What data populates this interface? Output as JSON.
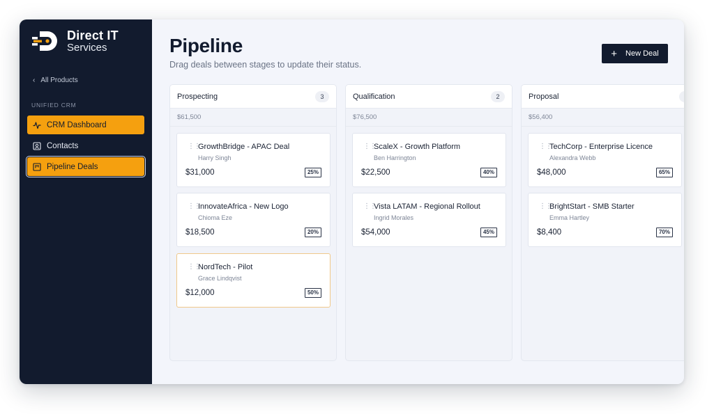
{
  "brand": {
    "name": "Direct IT",
    "subtitle": "Services"
  },
  "sidebar": {
    "back_label": "All Products",
    "section_label": "UNIFIED CRM",
    "items": [
      {
        "label": "CRM Dashboard",
        "icon": "activity-icon",
        "state": "active"
      },
      {
        "label": "Contacts",
        "icon": "contact-card-icon",
        "state": "default"
      },
      {
        "label": "Pipeline Deals",
        "icon": "kanban-icon",
        "state": "selected"
      }
    ]
  },
  "header": {
    "title": "Pipeline",
    "subtitle": "Drag deals between stages to update their status.",
    "new_deal_label": "New Deal"
  },
  "columns": [
    {
      "title": "Prospecting",
      "count": "3",
      "total": "$61,500",
      "cards": [
        {
          "title": "GrowthBridge - APAC Deal",
          "owner": "Harry Singh",
          "amount": "$31,000",
          "probability": "25%"
        },
        {
          "title": "InnovateAfrica - New Logo",
          "owner": "Chioma Eze",
          "amount": "$18,500",
          "probability": "20%"
        },
        {
          "title": "NordTech - Pilot",
          "owner": "Grace Lindqvist",
          "amount": "$12,000",
          "probability": "50%"
        }
      ]
    },
    {
      "title": "Qualification",
      "count": "2",
      "total": "$76,500",
      "cards": [
        {
          "title": "ScaleX - Growth Platform",
          "owner": "Ben Harrington",
          "amount": "$22,500",
          "probability": "40%"
        },
        {
          "title": "Vista LATAM - Regional Rollout",
          "owner": "Ingrid Morales",
          "amount": "$54,000",
          "probability": "45%"
        }
      ]
    },
    {
      "title": "Proposal",
      "count": "",
      "total": "$56,400",
      "cards": [
        {
          "title": "TechCorp - Enterprise Licence",
          "owner": "Alexandra Webb",
          "amount": "$48,000",
          "probability": "65%"
        },
        {
          "title": "BrightStart - SMB Starter",
          "owner": "Emma Hartley",
          "amount": "$8,400",
          "probability": "70%"
        }
      ]
    }
  ],
  "colors": {
    "sidebar_bg": "#121b2e",
    "accent": "#f5a00f",
    "page_bg": "#f3f5fb",
    "button_bg": "#121b2e"
  }
}
